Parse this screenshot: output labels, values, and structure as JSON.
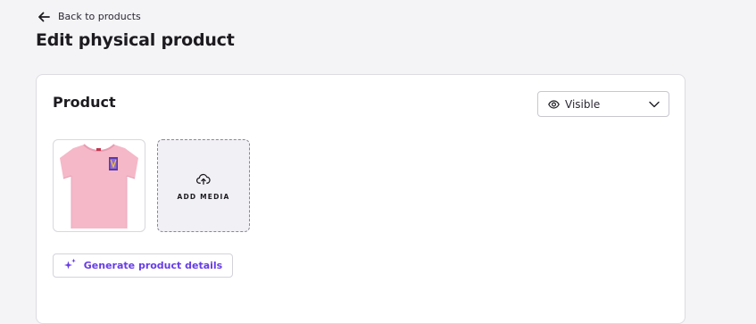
{
  "header": {
    "back_label": "Back to products",
    "page_title": "Edit physical product"
  },
  "product_card": {
    "title": "Product",
    "visibility": {
      "selected": "Visible"
    },
    "media": {
      "add_media_label": "ADD MEDIA"
    },
    "generate_label": "Generate product details"
  },
  "icons": {
    "back": "arrow-left-icon",
    "visibility": "eye-icon",
    "dropdown": "chevron-down-icon",
    "upload": "cloud-upload-icon",
    "ai": "sparkles-icon"
  },
  "colors": {
    "accent": "#673de6",
    "background": "#f4f4f6",
    "tshirt": "#f5b8c8"
  }
}
